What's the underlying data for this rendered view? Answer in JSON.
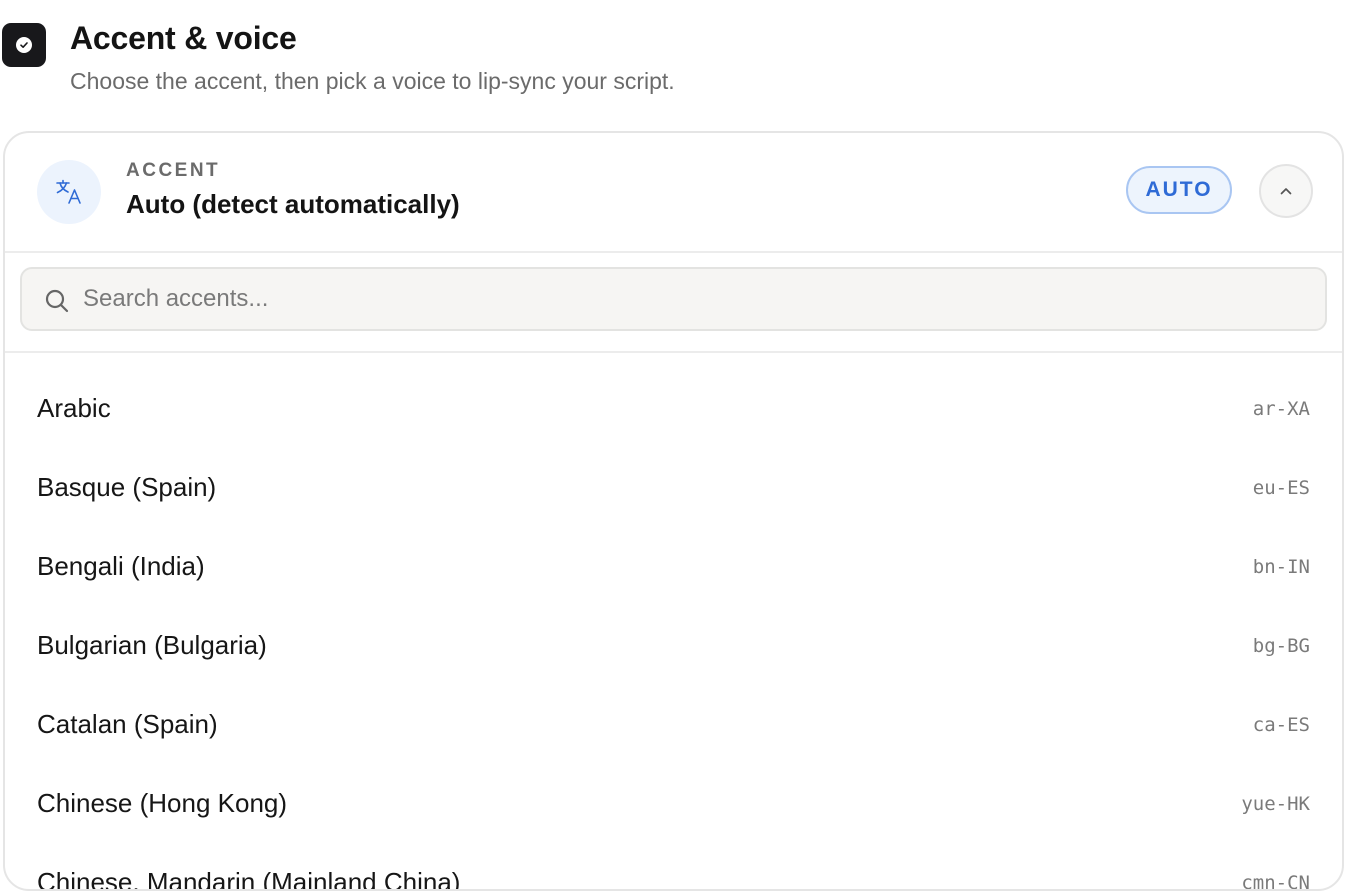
{
  "header": {
    "title": "Accent & voice",
    "subtitle": "Choose the accent, then pick a voice to lip-sync your script.",
    "status_icon": "check-circle-icon"
  },
  "accent_selector": {
    "label": "ACCENT",
    "selected_value": "Auto (detect automatically)",
    "badge": "AUTO",
    "icon": "translate-icon",
    "toggle_icon": "chevron-up-icon",
    "expanded": true
  },
  "search": {
    "placeholder": "Search accents...",
    "value": ""
  },
  "accents": [
    {
      "name": "Arabic",
      "code": "ar-XA"
    },
    {
      "name": "Basque (Spain)",
      "code": "eu-ES"
    },
    {
      "name": "Bengali (India)",
      "code": "bn-IN"
    },
    {
      "name": "Bulgarian (Bulgaria)",
      "code": "bg-BG"
    },
    {
      "name": "Catalan (Spain)",
      "code": "ca-ES"
    },
    {
      "name": "Chinese (Hong Kong)",
      "code": "yue-HK"
    },
    {
      "name": "Chinese, Mandarin (Mainland China)",
      "code": "cmn-CN"
    }
  ],
  "colors": {
    "accent_blue": "#2f6bd6",
    "badge_bg": "#edf4fd",
    "badge_border": "#a9c6f2",
    "dark": "#18181b",
    "muted_text": "#6b6b6b"
  }
}
